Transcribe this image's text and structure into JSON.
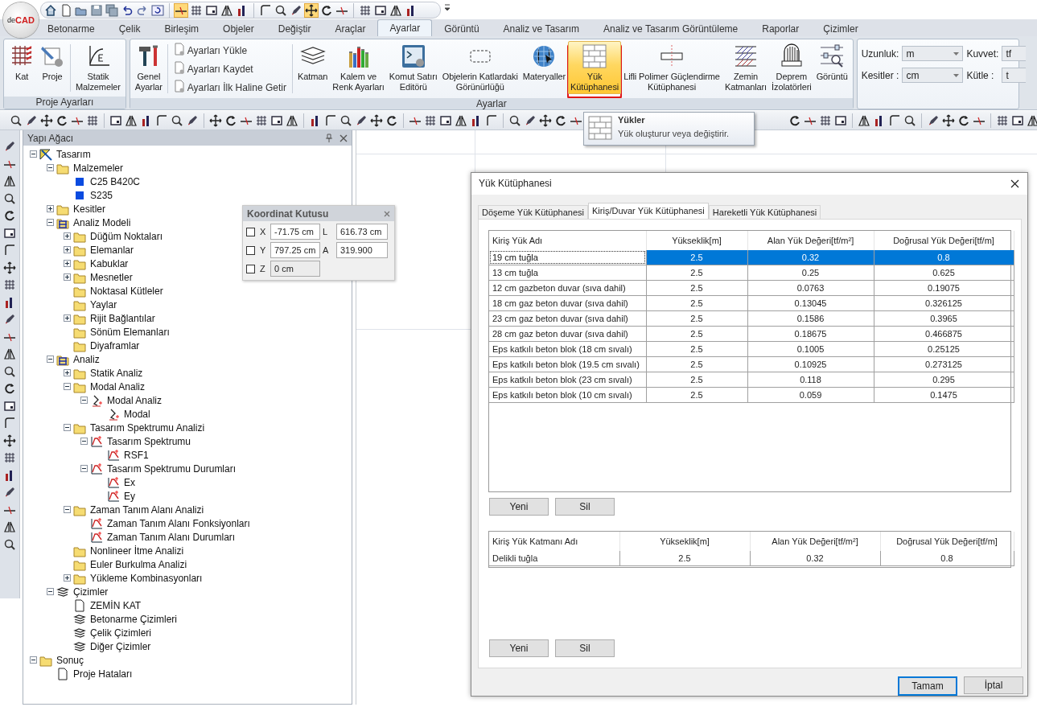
{
  "logo": {
    "parts": [
      "de",
      "CAD"
    ]
  },
  "menu_tabs": [
    {
      "label": "Betonarme",
      "selected": false
    },
    {
      "label": "Çelik",
      "selected": false
    },
    {
      "label": "Birleşim",
      "selected": false
    },
    {
      "label": "Objeler",
      "selected": false
    },
    {
      "label": "Değiştir",
      "selected": false
    },
    {
      "label": "Araçlar",
      "selected": false
    },
    {
      "label": "Ayarlar",
      "selected": true
    },
    {
      "label": "Görüntü",
      "selected": false
    },
    {
      "label": "Analiz ve Tasarım",
      "selected": false
    },
    {
      "label": "Analiz ve Tasarım Görüntüleme",
      "selected": false
    },
    {
      "label": "Raporlar",
      "selected": false
    },
    {
      "label": "Çizimler",
      "selected": false
    }
  ],
  "ribbon": {
    "groups": [
      {
        "label": "Proje Ayarları",
        "buttons": [
          {
            "kind": "large",
            "label": "Kat",
            "selected": false
          },
          {
            "kind": "large",
            "label": "Proje",
            "selected": false
          },
          {
            "kind": "separator"
          },
          {
            "kind": "large",
            "label": "Statik\nMalzemeler",
            "selected": false
          }
        ]
      },
      {
        "label": "Ayarlar",
        "buttons": [
          {
            "kind": "large",
            "label": "Genel\nAyarlar",
            "selected": false
          },
          {
            "kind": "separator"
          },
          {
            "kind": "small_stack",
            "items": [
              "Ayarları Yükle",
              "Ayarları Kaydet",
              "Ayarları İlk Haline Getir"
            ]
          },
          {
            "kind": "separator"
          },
          {
            "kind": "large",
            "label": "Katman",
            "selected": false
          },
          {
            "kind": "large",
            "label": "Kalem ve\nRenk Ayarları",
            "selected": false
          },
          {
            "kind": "large",
            "label": "Komut Satırı\nEditörü",
            "selected": false
          },
          {
            "kind": "large",
            "label": "Objelerin Katlardaki\nGörünürlüğü",
            "selected": false
          },
          {
            "kind": "large",
            "label": "Materyaller",
            "selected": false
          },
          {
            "kind": "large",
            "label": "Yük\nKütüphanesi",
            "selected": true
          },
          {
            "kind": "large",
            "label": "Lifli Polimer Güçlendirme\nKütüphanesi",
            "selected": false
          },
          {
            "kind": "large",
            "label": "Zemin\nKatmanları",
            "selected": false
          },
          {
            "kind": "large",
            "label": "Deprem\nİzolatörleri",
            "selected": false
          },
          {
            "kind": "large",
            "label": "Görüntü",
            "selected": false
          }
        ]
      }
    ],
    "units": [
      {
        "label": "Uzunluk:",
        "value": "m",
        "label2": "Kuvvet:",
        "value2": "tf"
      },
      {
        "label": "Kesitler :",
        "value": "cm",
        "label2": "Kütle :",
        "value2": "t"
      }
    ]
  },
  "tree_panel": {
    "title": "Yapı Ağacı",
    "items": [
      {
        "label": "Tasarım",
        "kind": "design",
        "expanded": true,
        "children": [
          {
            "label": "Malzemeler",
            "kind": "folder",
            "expanded": true,
            "children": [
              {
                "label": "C25 B420C",
                "kind": "material"
              },
              {
                "label": "S235",
                "kind": "material"
              }
            ]
          },
          {
            "label": "Kesitler",
            "kind": "folder",
            "expanded": false
          },
          {
            "label": "Analiz Modeli",
            "kind": "model",
            "expanded": true,
            "children": [
              {
                "label": "Düğüm Noktaları",
                "kind": "folder",
                "expanded": false
              },
              {
                "label": "Elemanlar",
                "kind": "folder",
                "expanded": false
              },
              {
                "label": "Kabuklar",
                "kind": "folder",
                "expanded": false
              },
              {
                "label": "Mesnetler",
                "kind": "folder",
                "expanded": false
              },
              {
                "label": "Noktasal Kütleler",
                "kind": "folder"
              },
              {
                "label": "Yaylar",
                "kind": "folder"
              },
              {
                "label": "Rijit Bağlantılar",
                "kind": "folder",
                "expanded": false
              },
              {
                "label": "Sönüm Elemanları",
                "kind": "folder"
              },
              {
                "label": "Diyaframlar",
                "kind": "folder"
              }
            ]
          },
          {
            "label": "Analiz",
            "kind": "model",
            "expanded": true,
            "children": [
              {
                "label": "Statik Analiz",
                "kind": "folder",
                "expanded": false
              },
              {
                "label": "Modal Analiz",
                "kind": "folder",
                "expanded": true,
                "children": [
                  {
                    "label": "Modal Analiz",
                    "kind": "modal",
                    "expanded": true,
                    "children": [
                      {
                        "label": "Modal",
                        "kind": "modal"
                      }
                    ]
                  }
                ]
              },
              {
                "label": "Tasarım Spektrumu Analizi",
                "kind": "folder",
                "expanded": true,
                "children": [
                  {
                    "label": "Tasarım Spektrumu",
                    "kind": "chart",
                    "expanded": true,
                    "children": [
                      {
                        "label": "RSF1",
                        "kind": "chart"
                      }
                    ]
                  },
                  {
                    "label": "Tasarım Spektrumu Durumları",
                    "kind": "chart",
                    "expanded": true,
                    "children": [
                      {
                        "label": "Ex",
                        "kind": "chart"
                      },
                      {
                        "label": "Ey",
                        "kind": "chart"
                      }
                    ]
                  }
                ]
              },
              {
                "label": "Zaman Tanım Alanı Analizi",
                "kind": "folder",
                "expanded": true,
                "children": [
                  {
                    "label": "Zaman Tanım Alanı Fonksiyonları",
                    "kind": "chart"
                  },
                  {
                    "label": "Zaman Tanım Alanı Durumları",
                    "kind": "chart"
                  }
                ]
              },
              {
                "label": "Nonlineer İtme Analizi",
                "kind": "folder"
              },
              {
                "label": "Euler Burkulma Analizi",
                "kind": "folder"
              },
              {
                "label": "Yükleme Kombinasyonları",
                "kind": "folder",
                "expanded": false
              }
            ]
          },
          {
            "label": "Çizimler",
            "kind": "drawings",
            "expanded": true,
            "children": [
              {
                "label": "ZEMİN KAT",
                "kind": "document"
              },
              {
                "label": "Betonarme Çizimleri",
                "kind": "drawings"
              },
              {
                "label": "Çelik Çizimleri",
                "kind": "drawings"
              },
              {
                "label": "Diğer Çizimler",
                "kind": "drawings"
              }
            ]
          }
        ]
      },
      {
        "label": "Sonuç",
        "kind": "folder",
        "expanded": true,
        "children": [
          {
            "label": "Proje Hataları",
            "kind": "document"
          }
        ]
      }
    ]
  },
  "coordinate_box": {
    "title": "Koordinat Kutusu",
    "rows": [
      {
        "axis": "X",
        "checked": false,
        "value": "-71.75 cm",
        "label2": "L",
        "value2": "616.73 cm"
      },
      {
        "axis": "Y",
        "checked": false,
        "value": "797.25 cm",
        "label2": "A",
        "value2": "319.900"
      },
      {
        "axis": "Z",
        "checked": false,
        "value": "0 cm"
      }
    ]
  },
  "tooltip": {
    "title": "Yükler",
    "text": "Yük oluşturur veya değiştirir."
  },
  "dialog": {
    "title": "Yük Kütüphanesi",
    "tabs": [
      {
        "label": "Döşeme Yük Kütüphanesi",
        "selected": false
      },
      {
        "label": "Kiriş/Duvar Yük Kütüphanesi",
        "selected": true
      },
      {
        "label": "Hareketli Yük Kütüphanesi",
        "selected": false
      }
    ],
    "table": {
      "columns": [
        "Kiriş Yük Adı",
        "Yükseklik[m]",
        "Alan Yük Değeri[tf/m²]",
        "Doğrusal Yük Değeri[tf/m]"
      ],
      "rows": [
        {
          "cells": [
            "19 cm tuğla",
            "2.5",
            "0.32",
            "0.8"
          ],
          "selected": true
        },
        {
          "cells": [
            "13 cm tuğla",
            "2.5",
            "0.25",
            "0.625"
          ],
          "selected": false
        },
        {
          "cells": [
            "12 cm gazbeton duvar (sıva dahil)",
            "2.5",
            "0.0763",
            "0.19075"
          ],
          "selected": false
        },
        {
          "cells": [
            "18 cm gaz beton duvar (sıva dahil)",
            "2.5",
            "0.13045",
            "0.326125"
          ],
          "selected": false
        },
        {
          "cells": [
            "23 cm gaz beton duvar  (sıva dahil)",
            "2.5",
            "0.1586",
            "0.3965"
          ],
          "selected": false
        },
        {
          "cells": [
            "28 cm gaz beton duvar  (sıva dahil)",
            "2.5",
            "0.18675",
            "0.466875"
          ],
          "selected": false
        },
        {
          "cells": [
            "Eps katkılı beton blok (18 cm sıvalı)",
            "2.5",
            "0.1005",
            "0.25125"
          ],
          "selected": false
        },
        {
          "cells": [
            "Eps katkılı beton blok (19.5 cm sıvalı)",
            "2.5",
            "0.10925",
            "0.273125"
          ],
          "selected": false
        },
        {
          "cells": [
            "Eps katkılı beton blok (23 cm sıvalı)",
            "2.5",
            "0.118",
            "0.295"
          ],
          "selected": false
        },
        {
          "cells": [
            "Eps katkılı beton blok (10 cm sıvalı)",
            "2.5",
            "0.059",
            "0.1475"
          ],
          "selected": false
        }
      ]
    },
    "table_buttons": [
      "Yeni",
      "Sil"
    ],
    "layer_table": {
      "columns": [
        "Kiriş Yük Katmanı Adı",
        "Yükseklik[m]",
        "Alan Yük Değeri[tf/m²]",
        "Doğrusal Yük Değeri[tf/m]"
      ],
      "rows": [
        {
          "cells": [
            "Delikli tuğla",
            "2.5",
            "0.32",
            "0.8"
          ]
        }
      ]
    },
    "layer_buttons": [
      "Yeni",
      "Sil"
    ],
    "footer_buttons": [
      {
        "label": "Tamam",
        "default": true
      },
      {
        "label": "İptal",
        "default": false
      }
    ]
  }
}
